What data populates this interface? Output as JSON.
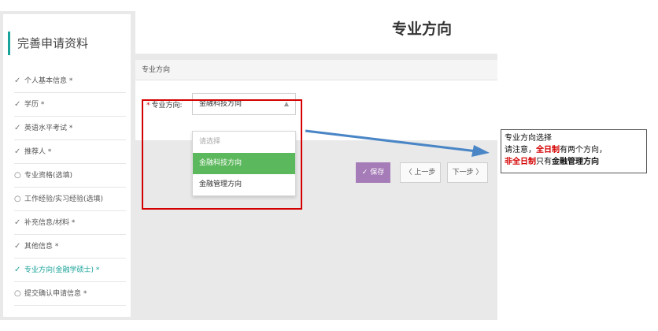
{
  "sidebar": {
    "title": "完善申请资料",
    "items": [
      {
        "mark": "✓",
        "label": "个人基本信息 *"
      },
      {
        "mark": "✓",
        "label": "学历 *"
      },
      {
        "mark": "✓",
        "label": "英语水平考试 *"
      },
      {
        "mark": "✓",
        "label": "推荐人 *"
      },
      {
        "mark": "○",
        "label": "专业资格(选填)"
      },
      {
        "mark": "○",
        "label": "工作经验/实习经验(选填)"
      },
      {
        "mark": "✓",
        "label": "补充信息/材料 *"
      },
      {
        "mark": "✓",
        "label": "其他信息 *"
      },
      {
        "mark": "✓",
        "label": "专业方向(金融学硕士) *"
      },
      {
        "mark": "○",
        "label": "提交确认申请信息 *"
      }
    ]
  },
  "header": {
    "title": "专业方向"
  },
  "panel": {
    "heading": "专业方向",
    "field_label": "专业方向:",
    "required_mark": "*",
    "select_value": "金融科技方向",
    "caret": "▲"
  },
  "dropdown": {
    "options": [
      "请选择",
      "金融科技方向",
      "金融管理方向"
    ],
    "selected": "金融科技方向"
  },
  "buttons": {
    "save": "✓ 保存",
    "prev": "〈 上一步",
    "next": "下一步 〉"
  },
  "note": {
    "line1": "专业方向选择",
    "line2_a": "请注意，",
    "line2_b": "全日制",
    "line2_c": "有两个方向，",
    "line3_a": "非全日制",
    "line3_b": "只有",
    "line3_c": "金融管理方向"
  },
  "colors": {
    "accent": "#1aa39a",
    "selected_option": "#5cb85c",
    "save_button": "#a57bb8",
    "highlight": "#d40000",
    "arrow": "#4a86c6"
  }
}
